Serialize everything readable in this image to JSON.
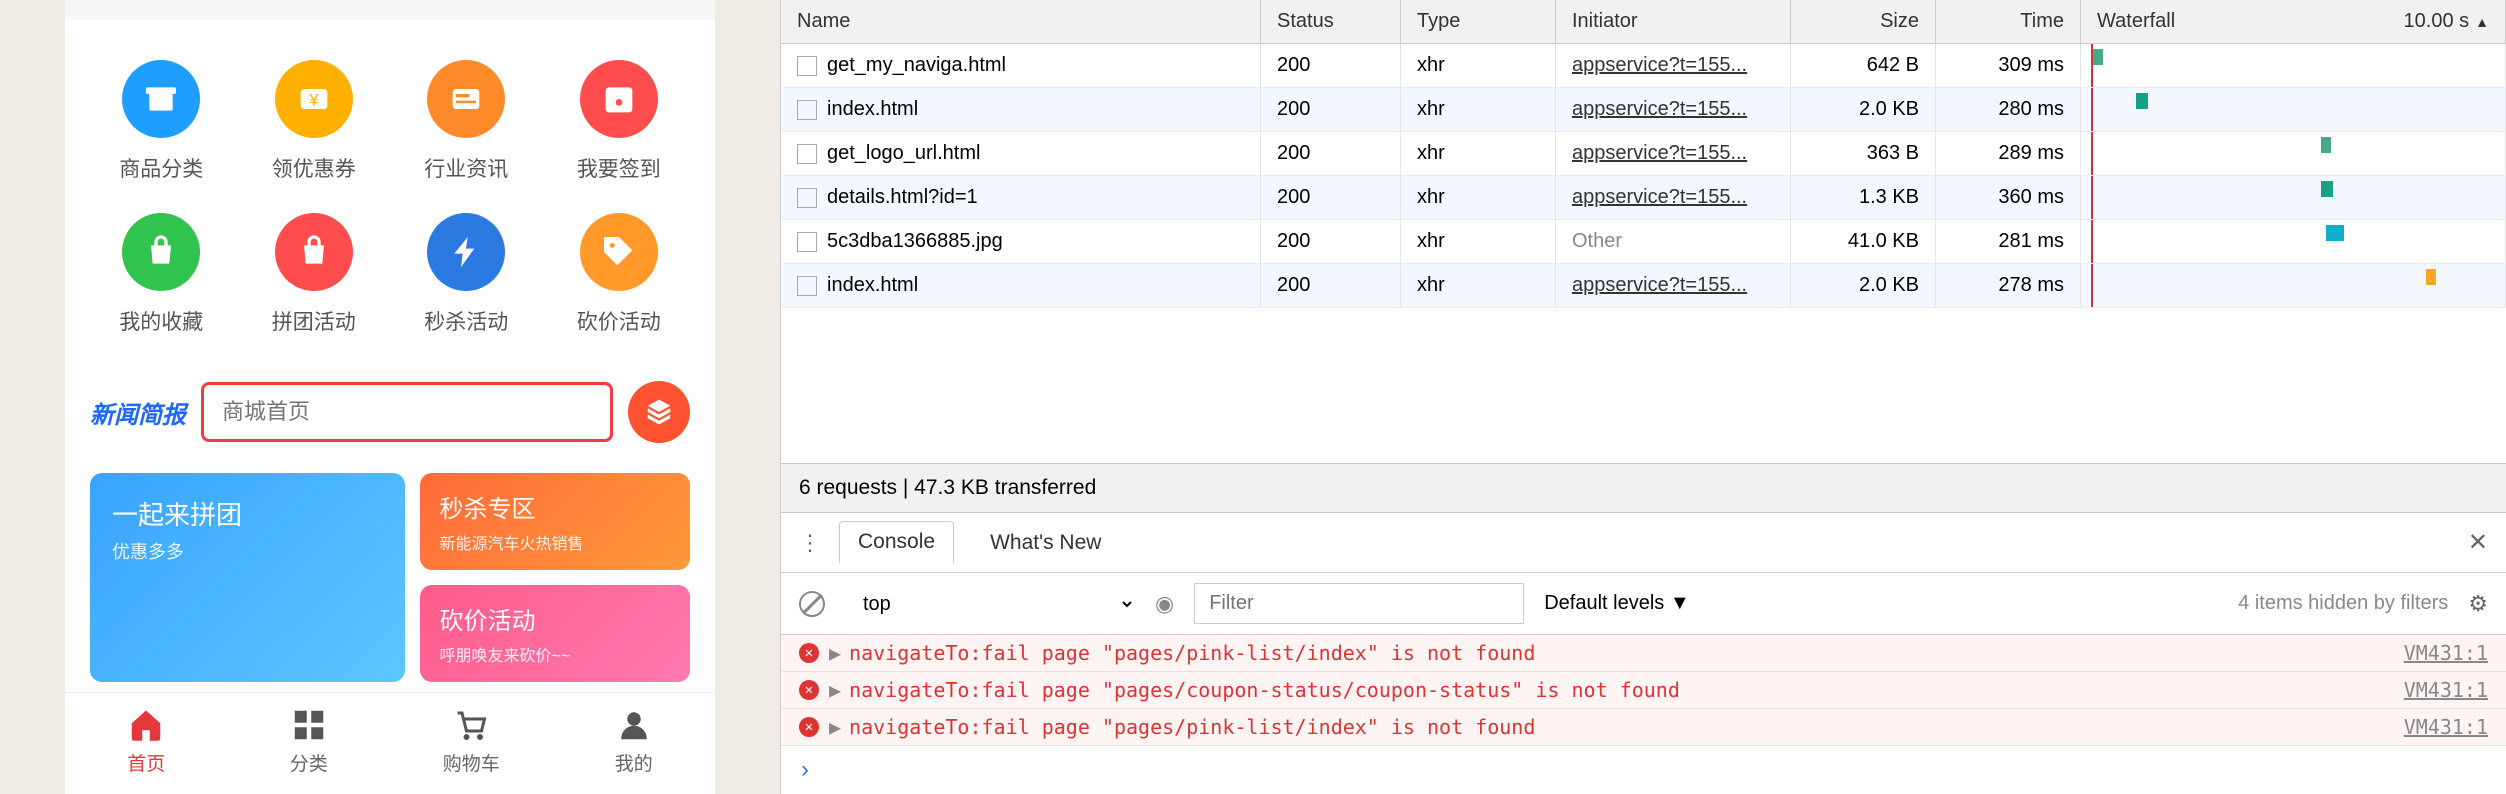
{
  "phone": {
    "grid": [
      {
        "label": "商品分类",
        "color": "#1e9fff",
        "icon": "shop"
      },
      {
        "label": "领优惠券",
        "color": "#ffb000",
        "icon": "coupon"
      },
      {
        "label": "行业资讯",
        "color": "#ff8a2a",
        "icon": "news"
      },
      {
        "label": "我要签到",
        "color": "#ff4d4d",
        "icon": "calendar"
      },
      {
        "label": "我的收藏",
        "color": "#30c44f",
        "icon": "bag"
      },
      {
        "label": "拼团活动",
        "color": "#ff4d4d",
        "icon": "bag2"
      },
      {
        "label": "秒杀活动",
        "color": "#2a7ae2",
        "icon": "bolt"
      },
      {
        "label": "砍价活动",
        "color": "#ff9a2a",
        "icon": "tag"
      }
    ],
    "news_logo": "新闻简报",
    "news_placeholder": "商城首页",
    "cards": {
      "big": {
        "title": "一起来拼团",
        "sub": "优惠多多",
        "bg": "linear-gradient(135deg,#3aa3ff,#5bc8ff)"
      },
      "r1": {
        "title": "秒杀专区",
        "sub": "新能源汽车火热销售",
        "bg": "linear-gradient(135deg,#ff6a3a,#ff9a3a)"
      },
      "r2": {
        "title": "砍价活动",
        "sub": "呼朋唤友来砍价~~",
        "bg": "linear-gradient(135deg,#ff5b8a,#ff7ab0)"
      }
    },
    "tabs": [
      {
        "label": "首页",
        "icon": "home",
        "active": true
      },
      {
        "label": "分类",
        "icon": "grid",
        "active": false
      },
      {
        "label": "购物车",
        "icon": "cart",
        "active": false
      },
      {
        "label": "我的",
        "icon": "user",
        "active": false
      }
    ]
  },
  "network": {
    "headers": {
      "name": "Name",
      "status": "Status",
      "type": "Type",
      "initiator": "Initiator",
      "size": "Size",
      "time": "Time",
      "waterfall": "Waterfall",
      "waterfall_scale": "10.00 s"
    },
    "rows": [
      {
        "name": "get_my_naviga.html",
        "status": "200",
        "type": "xhr",
        "initiator": "appservice?t=155...",
        "size": "642 B",
        "time": "309 ms",
        "wleft": 12,
        "wwidth": 10,
        "wcolor": "#4a8"
      },
      {
        "name": "index.html",
        "status": "200",
        "type": "xhr",
        "initiator": "appservice?t=155...",
        "size": "2.0 KB",
        "time": "280 ms",
        "wleft": 55,
        "wwidth": 12,
        "wcolor": "#16a085"
      },
      {
        "name": "get_logo_url.html",
        "status": "200",
        "type": "xhr",
        "initiator": "appservice?t=155...",
        "size": "363 B",
        "time": "289 ms",
        "wleft": 240,
        "wwidth": 10,
        "wcolor": "#4a8"
      },
      {
        "name": "details.html?id=1",
        "status": "200",
        "type": "xhr",
        "initiator": "appservice?t=155...",
        "size": "1.3 KB",
        "time": "360 ms",
        "wleft": 240,
        "wwidth": 12,
        "wcolor": "#16a085"
      },
      {
        "name": "5c3dba1366885.jpg",
        "status": "200",
        "type": "xhr",
        "initiator": "Other",
        "initiator_other": true,
        "size": "41.0 KB",
        "time": "281 ms",
        "wleft": 245,
        "wwidth": 18,
        "wcolor": "#0fb0c7"
      },
      {
        "name": "index.html",
        "status": "200",
        "type": "xhr",
        "initiator": "appservice?t=155...",
        "size": "2.0 KB",
        "time": "278 ms",
        "wleft": 345,
        "wwidth": 10,
        "wcolor": "#f6a623"
      }
    ],
    "summary": "6 requests | 47.3 KB transferred"
  },
  "console": {
    "tabs": {
      "console": "Console",
      "whatsnew": "What's New"
    },
    "toolbar": {
      "context": "top",
      "filter_placeholder": "Filter",
      "levels": "Default levels ▼",
      "hidden": "4 items hidden by filters"
    },
    "lines": [
      {
        "msg": "navigateTo:fail page \"pages/pink-list/index\" is not found",
        "src": "VM431:1"
      },
      {
        "msg": "navigateTo:fail page \"pages/coupon-status/coupon-status\" is not found",
        "src": "VM431:1"
      },
      {
        "msg": "navigateTo:fail page \"pages/pink-list/index\" is not found",
        "src": "VM431:1"
      }
    ]
  }
}
